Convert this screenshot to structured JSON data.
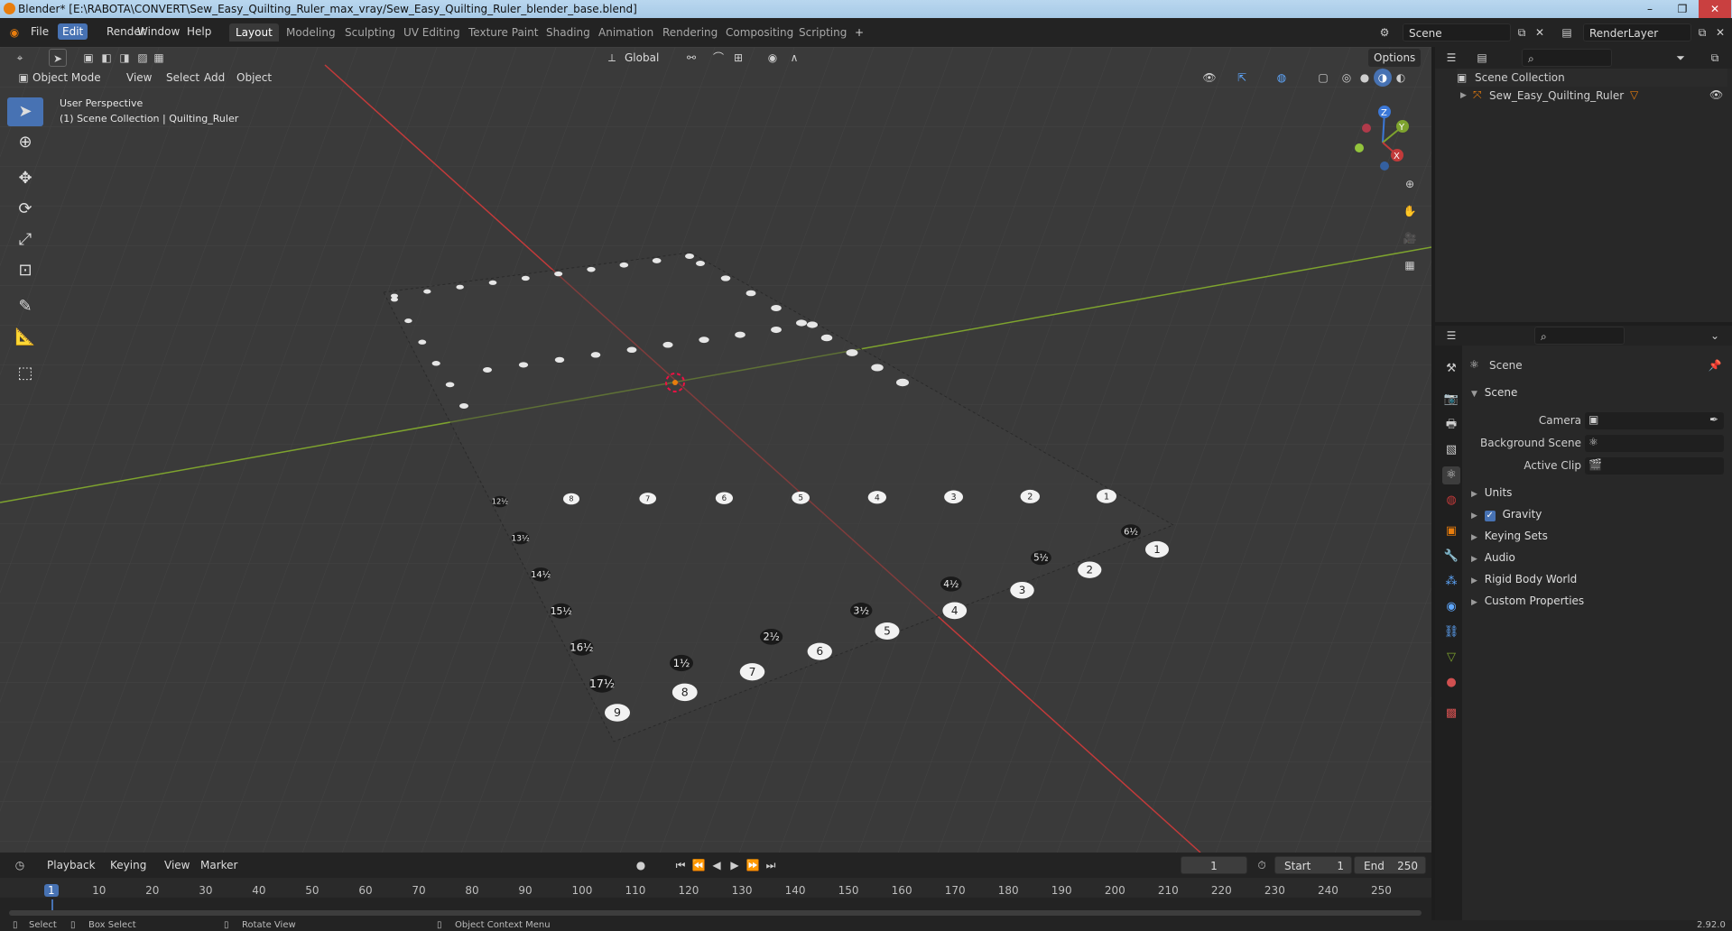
{
  "window": {
    "title": "Blender* [E:\\RABOTA\\CONVERT\\Sew_Easy_Quilting_Ruler_max_vray/Sew_Easy_Quilting_Ruler_blender_base.blend]",
    "controls": [
      "–",
      "❐",
      "✕"
    ]
  },
  "menu": [
    "File",
    "Edit",
    "Render",
    "Window",
    "Help"
  ],
  "workspaces": [
    "Layout",
    "Modeling",
    "Sculpting",
    "UV Editing",
    "Texture Paint",
    "Shading",
    "Animation",
    "Rendering",
    "Compositing",
    "Scripting"
  ],
  "scene_field": "Scene",
  "renderlayer_field": "RenderLayer",
  "viewport": {
    "mode": "Object Mode",
    "header_menus": [
      "View",
      "Select",
      "Add",
      "Object"
    ],
    "orientation": "Global",
    "options_label": "Options",
    "info_line1": "User Perspective",
    "info_line2": "(1) Scene Collection | Quilting_Ruler",
    "gizmo": {
      "z": "Z",
      "y": "Y",
      "x": "X"
    },
    "colors": {
      "bg": "#3a3a3a",
      "x_axis": "#c23a3a",
      "y_axis": "#7ea32e",
      "grid": "#444444"
    }
  },
  "ruler_labels": {
    "front_white": [
      "9",
      "8",
      "7",
      "6",
      "5",
      "4",
      "3",
      "2",
      "1"
    ],
    "front_black": [
      "17½",
      "16½",
      "15½",
      "14½",
      "13½",
      "12½"
    ],
    "mid_white": [
      "8",
      "7",
      "6",
      "5",
      "4",
      "3",
      "2",
      "1"
    ],
    "diag_black": [
      "1½",
      "2½",
      "3½",
      "4½",
      "5½",
      "6½"
    ]
  },
  "timeline": {
    "menus": [
      "Playback",
      "Keying",
      "View",
      "Marker"
    ],
    "current_frame": "1",
    "start_label": "Start",
    "start": "1",
    "end_label": "End",
    "end": "250",
    "ticks": [
      "1",
      "10",
      "20",
      "30",
      "40",
      "50",
      "60",
      "70",
      "80",
      "90",
      "100",
      "110",
      "120",
      "130",
      "140",
      "150",
      "160",
      "170",
      "180",
      "190",
      "200",
      "210",
      "220",
      "230",
      "240",
      "250"
    ]
  },
  "statusbar": {
    "items": [
      "Select",
      "Box Select",
      "Rotate View",
      "Object Context Menu"
    ],
    "version": "2.92.0"
  },
  "outliner": {
    "root": "Scene Collection",
    "items": [
      "Sew_Easy_Quilting_Ruler"
    ]
  },
  "properties": {
    "header": "Scene",
    "panel_title": "Scene",
    "fields": [
      {
        "label": "Camera"
      },
      {
        "label": "Background Scene"
      },
      {
        "label": "Active Clip"
      }
    ],
    "sections": [
      "Units",
      "Gravity",
      "Keying Sets",
      "Audio",
      "Rigid Body World",
      "Custom Properties"
    ]
  }
}
